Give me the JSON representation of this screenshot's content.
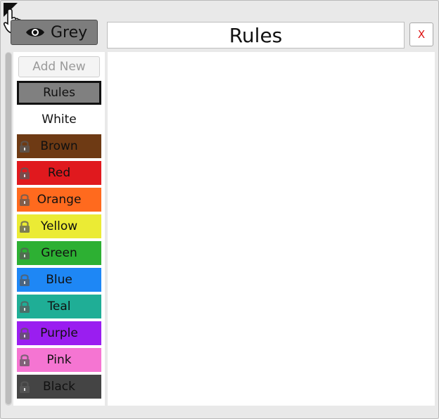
{
  "header": {
    "view_button_label": "Grey",
    "title": "Rules",
    "close_label": "X"
  },
  "sidebar": {
    "add_new_label": "Add New",
    "items": [
      {
        "label": "Rules",
        "style": "selected"
      },
      {
        "label": "White",
        "style": "plain"
      },
      {
        "label": "Brown",
        "color": "#6e3a14",
        "text_color": "#111111",
        "locked": true
      },
      {
        "label": "Red",
        "color": "#e0191e",
        "text_color": "#111111",
        "locked": true
      },
      {
        "label": "Orange",
        "color": "#ff6a1e",
        "text_color": "#111111",
        "locked": true
      },
      {
        "label": "Yellow",
        "color": "#ebeb34",
        "text_color": "#111111",
        "locked": true
      },
      {
        "label": "Green",
        "color": "#2db033",
        "text_color": "#111111",
        "locked": true
      },
      {
        "label": "Blue",
        "color": "#1e87f5",
        "text_color": "#111111",
        "locked": true
      },
      {
        "label": "Teal",
        "color": "#1fae96",
        "text_color": "#111111",
        "locked": true
      },
      {
        "label": "Purple",
        "color": "#9a1ef0",
        "text_color": "#111111",
        "locked": true
      },
      {
        "label": "Pink",
        "color": "#f575d2",
        "text_color": "#111111",
        "locked": true
      },
      {
        "label": "Black",
        "color": "#444444",
        "text_color": "#111111",
        "locked": true
      }
    ]
  },
  "colors": {
    "selected_bg": "#808080",
    "window_bg": "#e9e9e9",
    "close_text": "#dd1111"
  }
}
